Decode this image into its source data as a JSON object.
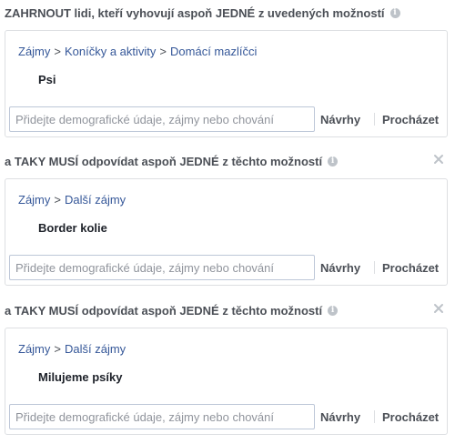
{
  "sections": [
    {
      "header": "ZAHRNOUT lidi, kteří vyhovují aspoň JEDNÉ z uvedených možností",
      "info_icon": "info-icon",
      "closable": false,
      "breadcrumb": [
        "Zájmy",
        "Koníčky a aktivity",
        "Domácí mazlíčci"
      ],
      "breadcrumb_separator": ">",
      "item": "Psi",
      "input_placeholder": "Přidejte demografické údaje, zájmy nebo chování",
      "suggestions_label": "Návrhy",
      "browse_label": "Procházet"
    },
    {
      "header": "a TAKY MUSÍ odpovídat aspoň JEDNÉ z těchto možností",
      "info_icon": "info-icon",
      "closable": true,
      "breadcrumb": [
        "Zájmy",
        "Další zájmy"
      ],
      "breadcrumb_separator": ">",
      "item": "Border kolie",
      "input_placeholder": "Přidejte demografické údaje, zájmy nebo chování",
      "suggestions_label": "Návrhy",
      "browse_label": "Procházet"
    },
    {
      "header": "a TAKY MUSÍ odpovídat aspoň JEDNÉ z těchto možností",
      "info_icon": "info-icon",
      "closable": true,
      "breadcrumb": [
        "Zájmy",
        "Další zájmy"
      ],
      "breadcrumb_separator": ">",
      "item": "Milujeme psíky",
      "input_placeholder": "Přidejte demografické údaje, zájmy nebo chování",
      "suggestions_label": "Návrhy",
      "browse_label": "Procházet"
    }
  ],
  "colors": {
    "link": "#365899",
    "border": "#dddfe2",
    "header_text": "#4b4f56",
    "placeholder": "#90949c"
  }
}
